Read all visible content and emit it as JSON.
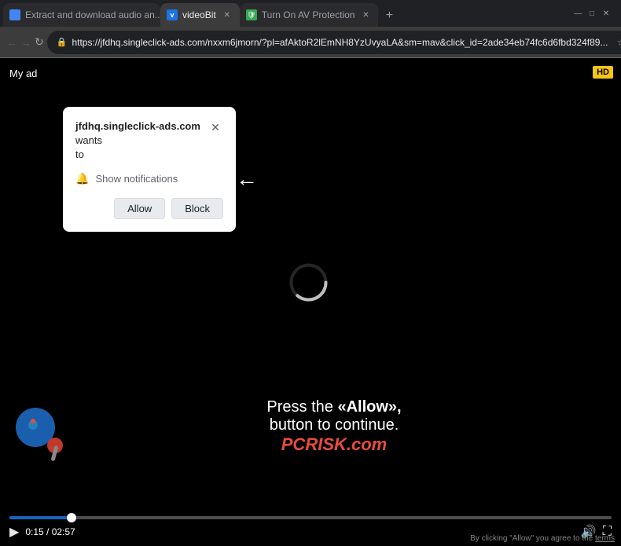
{
  "browser": {
    "tabs": [
      {
        "id": "tab1",
        "label": "Extract and download audio an...",
        "favicon_type": "blue",
        "active": true
      },
      {
        "id": "tab2",
        "label": "videoBit",
        "favicon_type": "video",
        "active": true
      },
      {
        "id": "tab3",
        "label": "Turn On AV Protection",
        "favicon_type": "shield",
        "active": false
      }
    ],
    "url": "https://jfdhq.singleclick-ads.com/nxxm6jmorn/?pl=afAktoR2lEmNH8YzUvyaLA&sm=mav&click_id=2ade34eb74fc6d6fbd324f89...",
    "new_tab_label": "+",
    "window_controls": {
      "minimize": "—",
      "maximize": "□",
      "close": "✕"
    }
  },
  "popup": {
    "title_site": "jfdhq.singleclick-ads.com",
    "title_wants": " wants",
    "title_to": "to",
    "close_label": "✕",
    "notification_text": "Show notifications",
    "allow_label": "Allow",
    "block_label": "Block"
  },
  "video": {
    "label": "My ad",
    "hd_badge": "HD",
    "time_current": "0:15",
    "time_total": "02:57",
    "progress_percent": 10
  },
  "overlay": {
    "press_text": "Press the",
    "allow_bold": "«Allow»,",
    "continue_text": "button to continue.",
    "site_prefix": "PC",
    "site_suffix": "RISK.com"
  },
  "disclaimer": {
    "text": "By clicking \"Allow\" you agree to the",
    "link_text": "terms"
  },
  "arrow": "←"
}
